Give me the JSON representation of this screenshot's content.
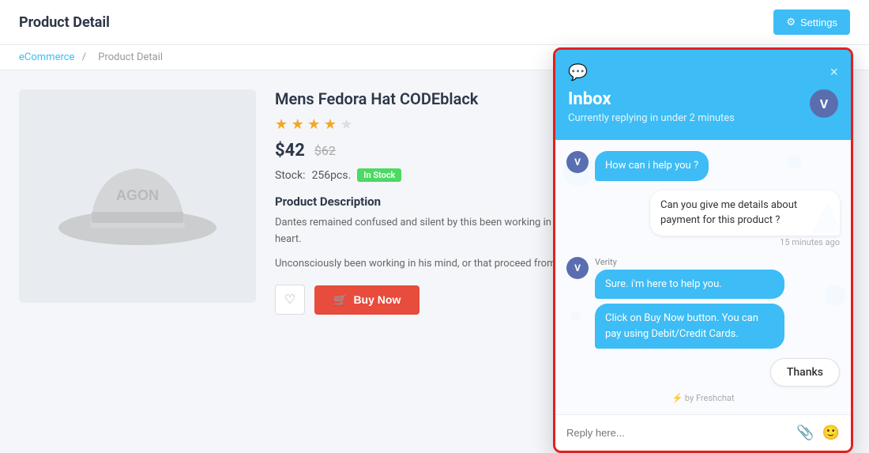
{
  "page": {
    "title": "Product Detail",
    "breadcrumb_link": "eCommerce",
    "breadcrumb_current": "Product Detail",
    "settings_label": "Settings"
  },
  "product": {
    "name": "Mens Fedora Hat CODEblack",
    "rating": 3.5,
    "price_new": "$42",
    "price_old": "$62",
    "stock_label": "Stock:",
    "stock_qty": "256pcs.",
    "stock_status": "In Stock",
    "desc_title": "Product Description",
    "desc_text1": "Dantes remained confused and silent by this been working in his mind, or rather soul; for from the head and those from the heart.",
    "desc_text2": "Unconsciously been working in his mind, or that proceed from the head and those from",
    "wishlist_label": "♡",
    "buy_now_label": "Buy Now"
  },
  "chat": {
    "icon": "💬",
    "close_label": "×",
    "avatar_initials": "V",
    "title": "Inbox",
    "subtitle": "Currently replying in under 2 minutes",
    "messages": [
      {
        "id": 1,
        "type": "agent",
        "avatar": "V",
        "text": "How can i help you ?",
        "meta": ""
      },
      {
        "id": 2,
        "type": "user",
        "text": "Can you give me details about payment for this product ?",
        "meta": "15 minutes ago"
      },
      {
        "id": 3,
        "type": "agent",
        "sender": "Verity",
        "avatar": "V",
        "text": "Sure. i'm here to help you.",
        "meta": ""
      },
      {
        "id": 4,
        "type": "agent",
        "avatar": "V",
        "text": "Click on Buy Now button. You can pay using Debit/Credit Cards.",
        "meta": ""
      }
    ],
    "quick_reply": "Thanks",
    "powered_by": "⚡ by Freshchat",
    "reply_placeholder": "Reply here...",
    "attach_icon": "📎",
    "emoji_icon": "😊"
  }
}
